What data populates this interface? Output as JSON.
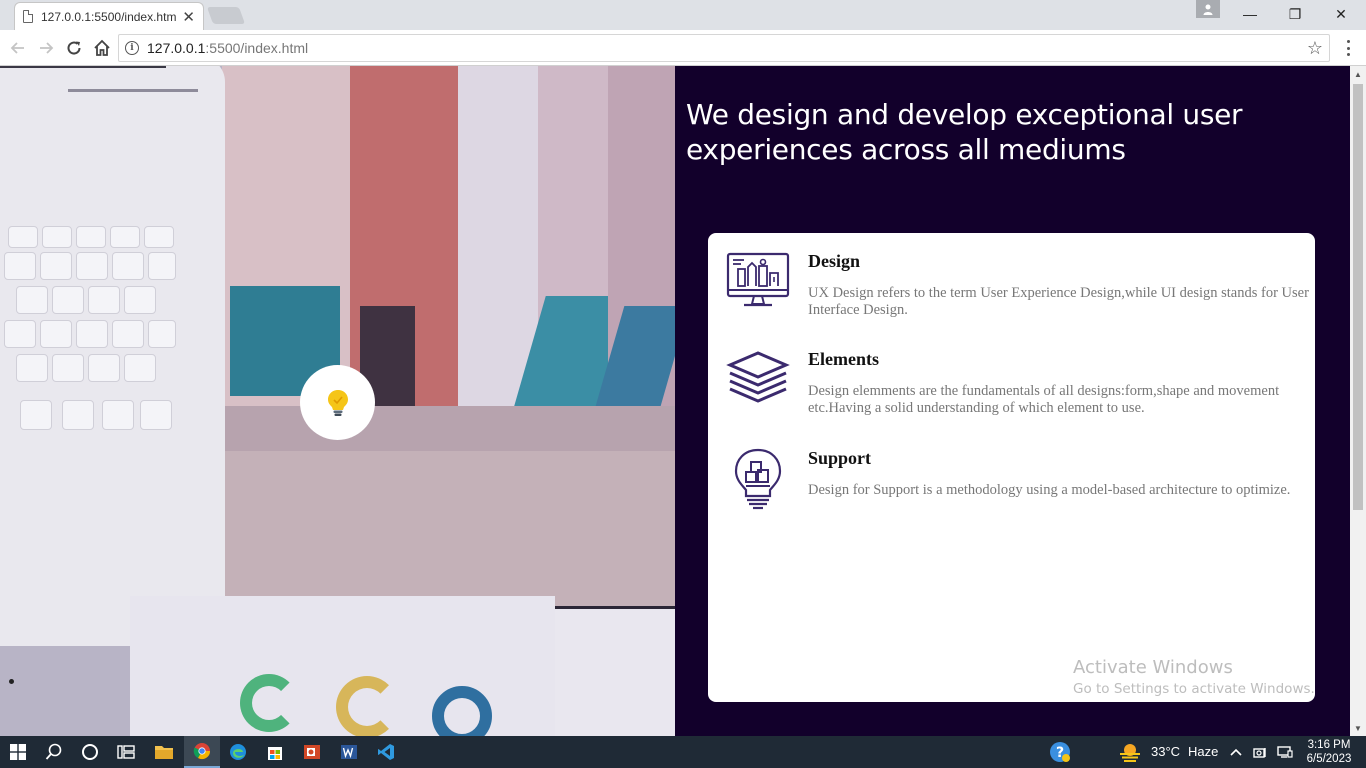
{
  "browser": {
    "tab_title": "127.0.0.1:5500/index.htm",
    "tab_close": "✕",
    "url_host": "127.0.0.1",
    "url_path": ":5500/index.html",
    "minimize": "—",
    "maximize": "❐",
    "close": "✕"
  },
  "page": {
    "headline": "We design and develop exceptional user experiences across all mediums",
    "features": [
      {
        "title": "Design",
        "description": "UX Design refers to the term User Experience Design,while UI design stands for User Interface Design.",
        "icon": "monitor-design-icon"
      },
      {
        "title": "Elements",
        "description": "Design elemments are the fundamentals of all designs:form,shape and movement etc.Having a solid understanding of which element to use.",
        "icon": "layers-icon"
      },
      {
        "title": "Support",
        "description": "Design for Support is a methodology using a model-based architecture to optimize.",
        "icon": "lightbulb-cubes-icon"
      }
    ],
    "watermark": {
      "line1": "Activate Windows",
      "line2": "Go to Settings to activate Windows."
    }
  },
  "taskbar": {
    "weather_temp": "33°C",
    "weather_desc": "Haze",
    "time": "3:16 PM",
    "date": "6/5/2023"
  },
  "colors": {
    "right_bg": "#12002b",
    "icon_purple": "#3b2a6e",
    "bulb_yellow": "#f5c518"
  }
}
